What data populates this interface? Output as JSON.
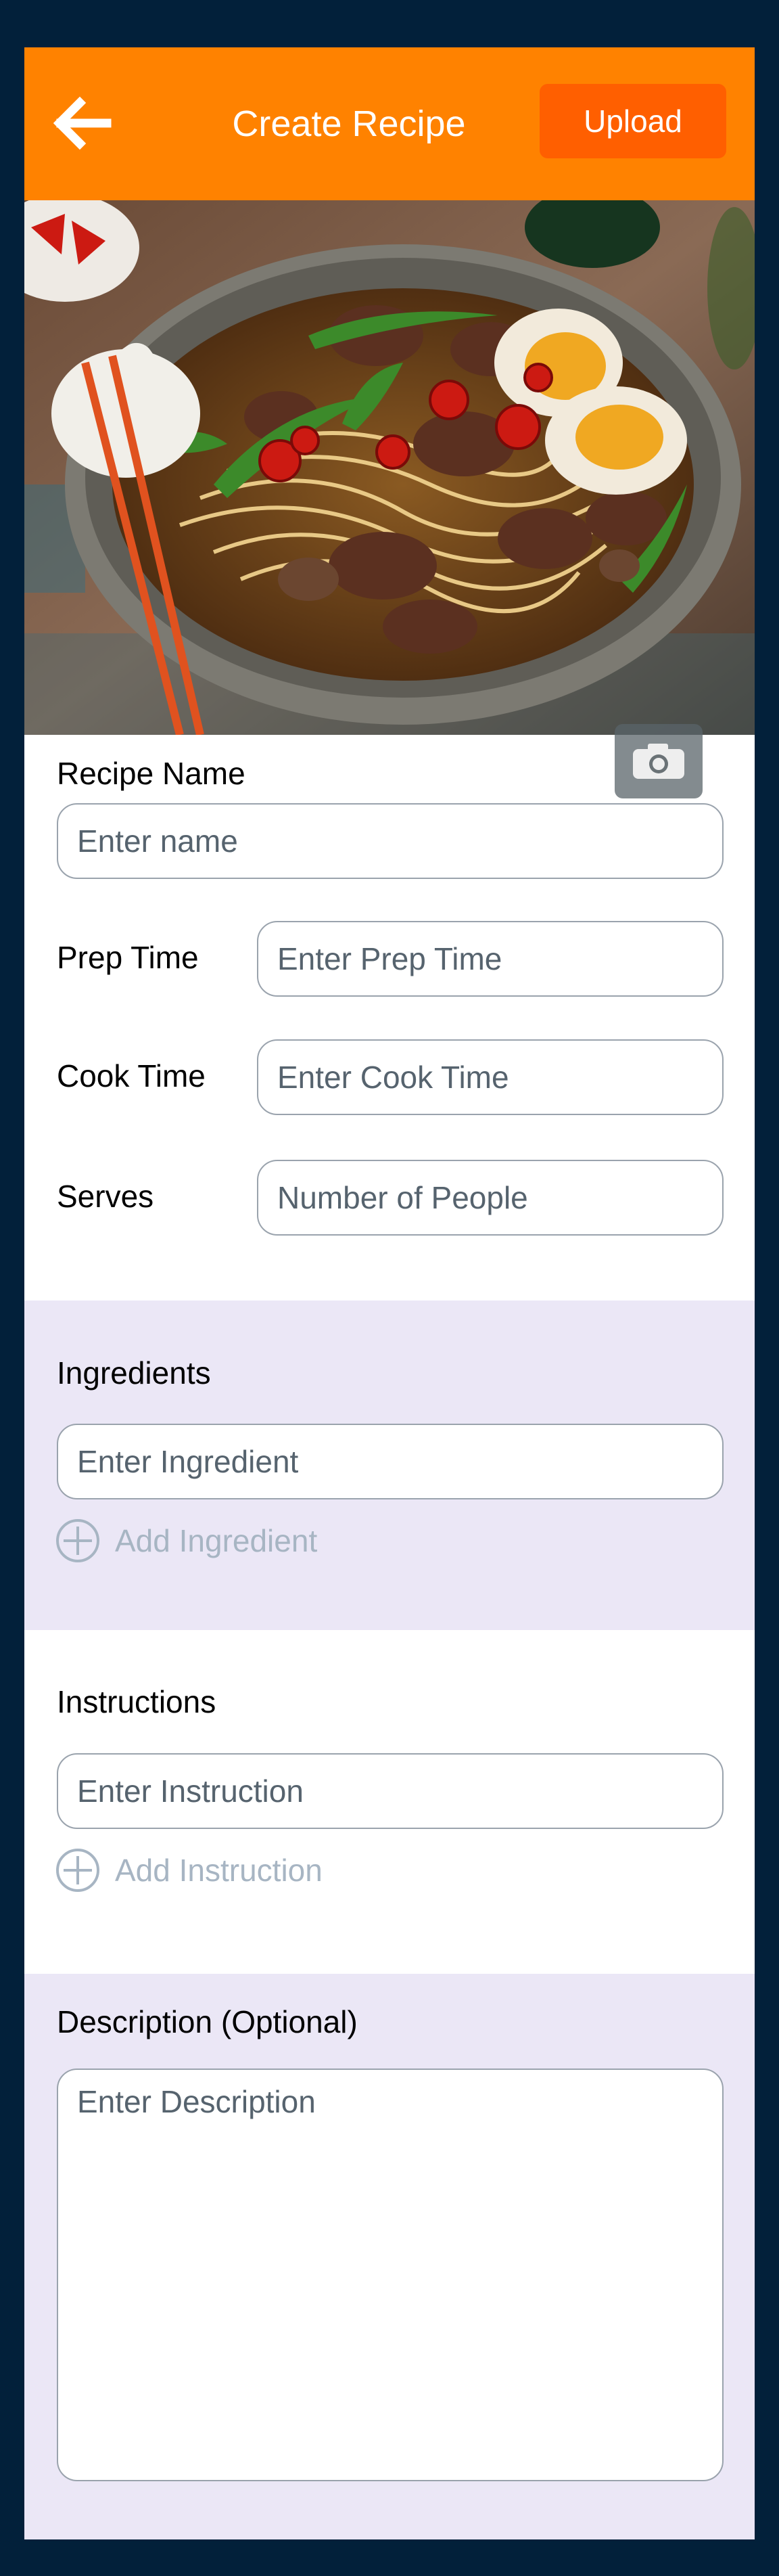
{
  "header": {
    "title": "Create Recipe",
    "upload_label": "Upload",
    "background_color": "#ff8200",
    "upload_color": "#ff5f00",
    "back_icon": "arrow-left-icon"
  },
  "hero": {
    "camera_icon": "camera-icon"
  },
  "details": {
    "recipe_name": {
      "label": "Recipe Name",
      "placeholder": "Enter name"
    },
    "prep_time": {
      "label": "Prep Time",
      "placeholder": "Enter Prep Time"
    },
    "cook_time": {
      "label": "Cook Time",
      "placeholder": "Enter Cook Time"
    },
    "serves": {
      "label": "Serves",
      "placeholder": "Number of People"
    }
  },
  "ingredients": {
    "heading": "Ingredients",
    "placeholder": "Enter Ingredient",
    "add_label": "Add Ingredient",
    "add_icon": "plus-circle-icon"
  },
  "instructions": {
    "heading": "Instructions",
    "placeholder": "Enter Instruction",
    "add_label": "Add Instruction",
    "add_icon": "plus-circle-icon"
  },
  "description": {
    "heading": "Description (Optional)",
    "placeholder": "Enter Description"
  },
  "colors": {
    "page_background": "#02203a",
    "tinted_section": "#ebe7f6",
    "add_link": "#a7b5c3"
  }
}
